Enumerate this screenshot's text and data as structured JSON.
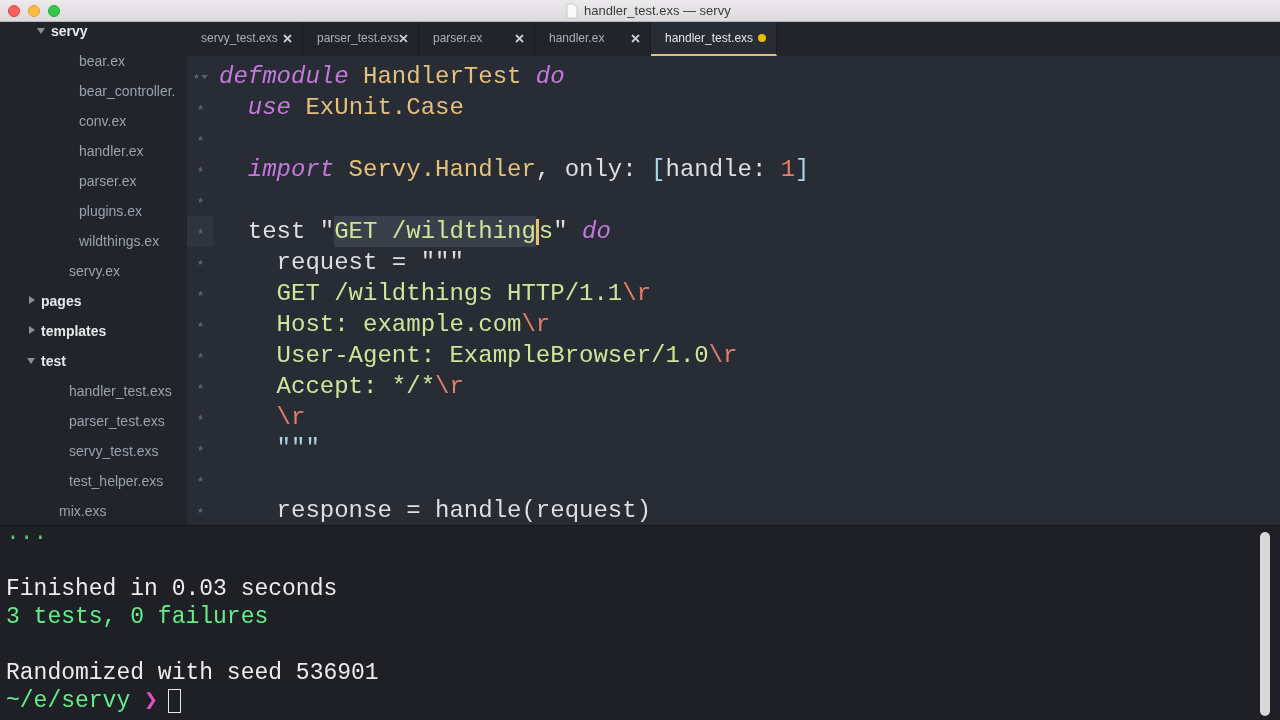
{
  "window": {
    "title": "handler_test.exs — servy"
  },
  "sidebar": {
    "items": [
      {
        "children": [
          {
            "label": "servy",
            "kind": "folder",
            "expanded": true,
            "children": [
              {
                "label": "bear.ex",
                "kind": "file"
              },
              {
                "label": "bear_controller.",
                "kind": "file"
              },
              {
                "label": "conv.ex",
                "kind": "file"
              },
              {
                "label": "handler.ex",
                "kind": "file"
              },
              {
                "label": "parser.ex",
                "kind": "file"
              },
              {
                "label": "plugins.ex",
                "kind": "file"
              },
              {
                "label": "wildthings.ex",
                "kind": "file"
              }
            ]
          },
          {
            "label": "servy.ex",
            "kind": "file"
          }
        ]
      },
      {
        "label": "pages",
        "kind": "folder",
        "expanded": false
      },
      {
        "label": "templates",
        "kind": "folder",
        "expanded": false
      },
      {
        "label": "test",
        "kind": "folder",
        "expanded": true,
        "children": [
          {
            "label": "handler_test.exs",
            "kind": "file"
          },
          {
            "label": "parser_test.exs",
            "kind": "file"
          },
          {
            "label": "servy_test.exs",
            "kind": "file"
          },
          {
            "label": "test_helper.exs",
            "kind": "file"
          }
        ]
      },
      {
        "label": "mix.exs",
        "kind": "file"
      }
    ]
  },
  "tabs": [
    {
      "label": "servy_test.exs",
      "selected": false,
      "modified": false
    },
    {
      "label": "parser_test.exs",
      "selected": false,
      "modified": false
    },
    {
      "label": "parser.ex",
      "selected": false,
      "modified": false
    },
    {
      "label": "handler.ex",
      "selected": false,
      "modified": false
    },
    {
      "label": "handler_test.exs",
      "selected": true,
      "modified": true
    }
  ],
  "editor": {
    "lines": [
      {
        "current": false,
        "tokens": [
          {
            "text": "defmodule",
            "kind": "keyword"
          },
          {
            "text": " HandlerTest ",
            "kind": "module"
          },
          {
            "text": "do",
            "kind": "keyword"
          }
        ]
      },
      {
        "current": false,
        "tokens": [
          {
            "text": "  use",
            "kind": "keyword"
          },
          {
            "text": " ExUnit.Case",
            "kind": "module"
          }
        ]
      },
      {
        "current": false
      },
      {
        "current": false,
        "tokens": [
          {
            "text": "  import",
            "kind": "keyword"
          },
          {
            "text": " Servy.Handler",
            "kind": "module"
          },
          {
            "text": ", only: ",
            "kind": "plain"
          },
          {
            "text": "[",
            "kind": "bracket"
          },
          {
            "text": "handle: ",
            "kind": "plain"
          },
          {
            "text": "1",
            "kind": "number"
          },
          {
            "text": "]",
            "kind": "bracket"
          }
        ]
      },
      {
        "current": false
      },
      {
        "current": true,
        "tokens": [
          {
            "text": "  test \"",
            "kind": "plain"
          },
          {
            "text": "GET /wildthing",
            "kind": "string",
            "selected": true
          },
          {
            "text": "s",
            "kind": "string",
            "caret": true
          },
          {
            "text": "\" ",
            "kind": "plain"
          },
          {
            "text": "do",
            "kind": "keyword"
          }
        ]
      },
      {
        "current": false,
        "tokens": [
          {
            "text": "    request = \"\"\"",
            "kind": "plain"
          }
        ]
      },
      {
        "current": false,
        "tokens": [
          {
            "text": "    GET /wildthings HTTP/1.1",
            "kind": "string"
          },
          {
            "text": "\\r",
            "kind": "escape"
          }
        ]
      },
      {
        "current": false,
        "tokens": [
          {
            "text": "    Host: example.com",
            "kind": "string"
          },
          {
            "text": "\\r",
            "kind": "escape"
          }
        ]
      },
      {
        "current": false,
        "tokens": [
          {
            "text": "    User-Agent: ExampleBrowser/1.0",
            "kind": "string"
          },
          {
            "text": "\\r",
            "kind": "escape"
          }
        ]
      },
      {
        "current": false,
        "tokens": [
          {
            "text": "    Accept: */*",
            "kind": "string"
          },
          {
            "text": "\\r",
            "kind": "escape"
          }
        ]
      },
      {
        "current": false,
        "tokens": [
          {
            "text": "    \\r",
            "kind": "escape"
          }
        ]
      },
      {
        "current": false,
        "tokens": [
          {
            "text": "    \"\"\"",
            "kind": "bracket"
          }
        ]
      },
      {
        "current": false
      },
      {
        "current": false,
        "tokens": [
          {
            "text": "    response = handle(request)",
            "kind": "plain"
          }
        ]
      }
    ]
  },
  "terminal": {
    "lines": [
      {
        "kind": "progress",
        "text": "..."
      },
      {
        "kind": "blank"
      },
      {
        "kind": "plain",
        "text": "Finished in 0.03 seconds"
      },
      {
        "kind": "success",
        "text": "3 tests, 0 failures"
      },
      {
        "kind": "blank"
      },
      {
        "kind": "plain",
        "text": "Randomized with seed 536901"
      },
      {
        "kind": "prompt",
        "path": "~/e/servy",
        "symbol": "❯"
      }
    ]
  }
}
